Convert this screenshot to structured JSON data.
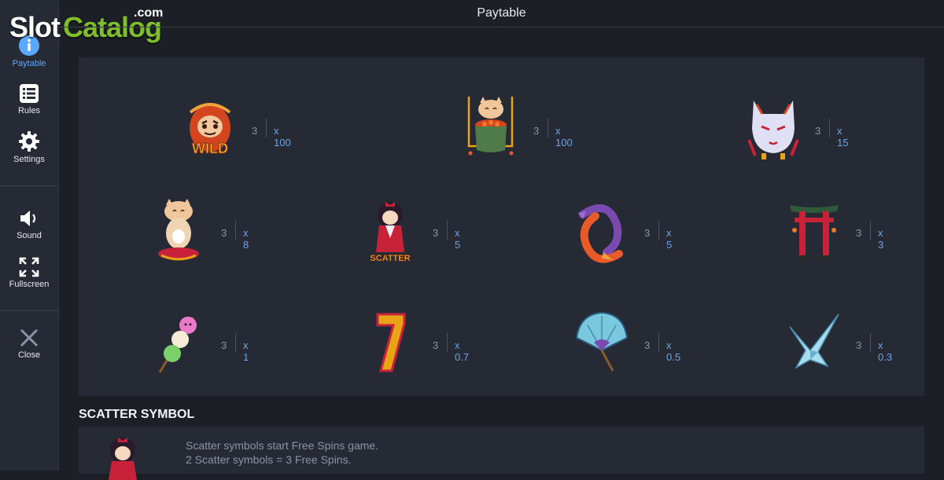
{
  "header": {
    "title": "Paytable"
  },
  "watermark": {
    "part1": "Slot",
    "part2": "Catalog",
    "part3": ".com"
  },
  "sidebar": {
    "items": [
      {
        "label": "Paytable",
        "icon": "info-icon",
        "active": true
      },
      {
        "label": "Rules",
        "icon": "list-icon"
      },
      {
        "label": "Settings",
        "icon": "gear-icon"
      },
      {
        "label": "Sound",
        "icon": "speaker-icon"
      },
      {
        "label": "Fullscreen",
        "icon": "fullscreen-icon"
      },
      {
        "label": "Close",
        "icon": "close-icon"
      }
    ]
  },
  "paytable": {
    "rows": [
      [
        {
          "symbol": "wild-daruma",
          "count": "3",
          "payout": "x 100"
        },
        {
          "symbol": "lucky-cat-bowl",
          "count": "3",
          "payout": "x 100",
          "highlighted": true
        },
        {
          "symbol": "kitsune-mask",
          "count": "3",
          "payout": "x 15"
        }
      ],
      [
        {
          "symbol": "maneki-neko",
          "count": "3",
          "payout": "x 8"
        },
        {
          "symbol": "scatter-kokeshi",
          "count": "3",
          "payout": "x 5"
        },
        {
          "symbol": "koi-fish",
          "count": "3",
          "payout": "x 5"
        },
        {
          "symbol": "torii-gate",
          "count": "3",
          "payout": "x 3"
        }
      ],
      [
        {
          "symbol": "dango",
          "count": "3",
          "payout": "x 1"
        },
        {
          "symbol": "seven",
          "count": "3",
          "payout": "x 0.7"
        },
        {
          "symbol": "fan",
          "count": "3",
          "payout": "x 0.5"
        },
        {
          "symbol": "origami-crane",
          "count": "3",
          "payout": "x 0.3"
        }
      ]
    ]
  },
  "scatter": {
    "title": "SCATTER SYMBOL",
    "lines": [
      "Scatter symbols start Free Spins game.",
      "2 Scatter symbols = 3 Free Spins."
    ]
  },
  "colors": {
    "accent": "#5aa8ff",
    "payout": "#6fa3e8",
    "gold": "#e8a317",
    "background": "#1d1f27",
    "panel": "#262a35"
  }
}
